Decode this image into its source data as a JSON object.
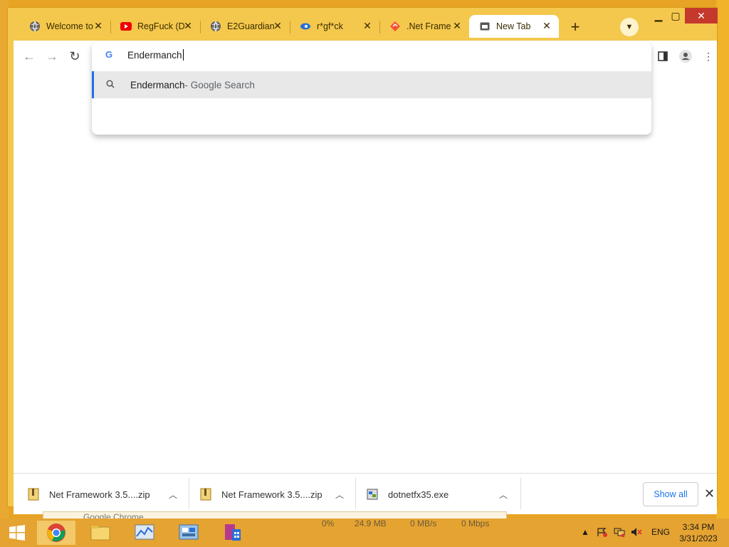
{
  "browser": {
    "tabs": [
      {
        "title": "Welcome to",
        "icon": "globe-icon"
      },
      {
        "title": "RegFuck (D",
        "icon": "youtube-icon"
      },
      {
        "title": "E2Guardian",
        "icon": "globe-icon"
      },
      {
        "title": "r*gf*ck",
        "icon": "blue-swirl-icon"
      },
      {
        "title": ".Net Frame",
        "icon": "diamond-icon"
      },
      {
        "title": "New Tab",
        "icon": "new-tab-icon",
        "active": true
      }
    ],
    "omnibox": {
      "value": "Endermanch",
      "suggestion_query": "Endermanch",
      "suggestion_desc": " - Google Search"
    }
  },
  "downloads": {
    "items": [
      {
        "name": "Net Framework 3.5....zip"
      },
      {
        "name": "Net Framework 3.5....zip"
      },
      {
        "name": "dotnetfx35.exe"
      }
    ],
    "show_all_label": "Show all"
  },
  "background_window": {
    "title": "Google Chrome",
    "stats": [
      "0%",
      "24.9 MB",
      "0 MB/s",
      "0 Mbps"
    ]
  },
  "taskbar": {
    "language": "ENG",
    "time": "3:34 PM",
    "date": "3/31/2023"
  },
  "colors": {
    "accent": "#f4c84d",
    "taskbar": "#e5a331",
    "link": "#1a73e8"
  }
}
